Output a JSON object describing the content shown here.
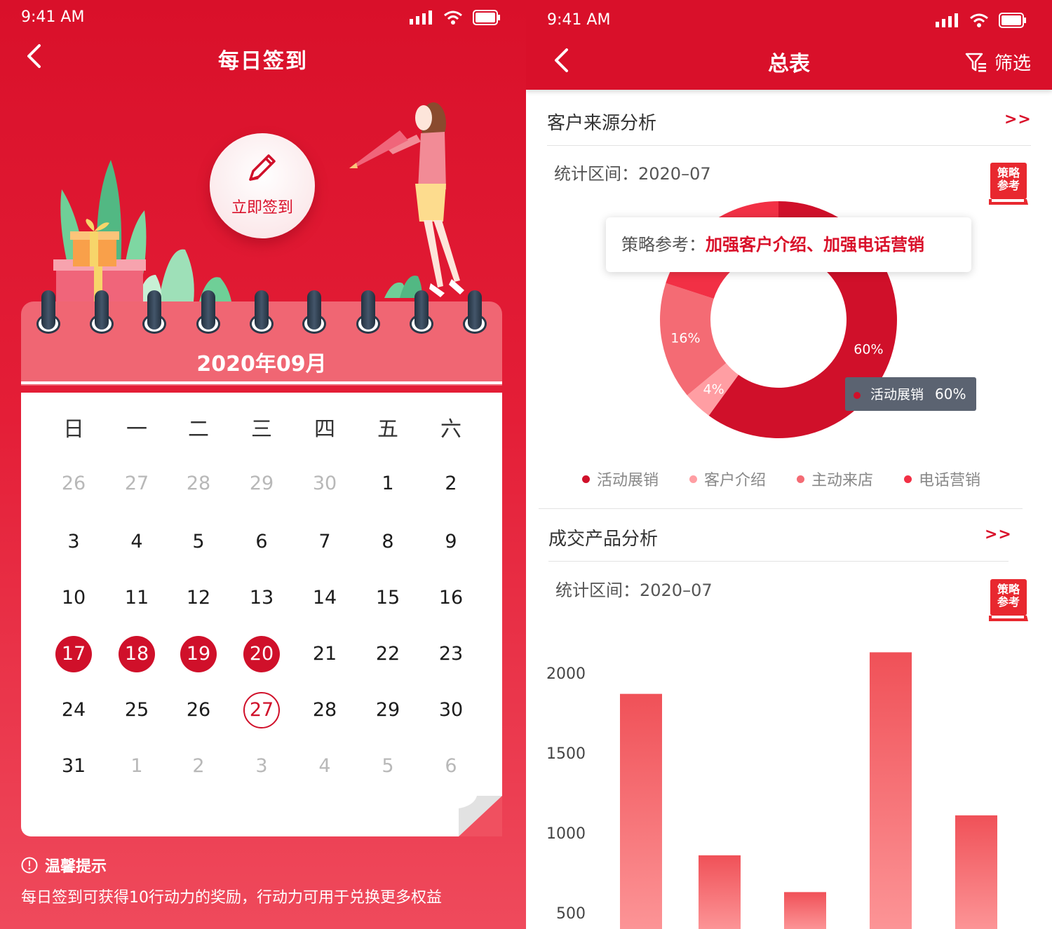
{
  "left": {
    "status": {
      "time": "9:41 AM"
    },
    "nav": {
      "title": "每日签到"
    },
    "checkin_button": {
      "label": "立即签到"
    },
    "calendar": {
      "month": "2020年09月",
      "weekdays": [
        "日",
        "一",
        "二",
        "三",
        "四",
        "五",
        "六"
      ],
      "days": [
        [
          "26",
          "27",
          "28",
          "29",
          "30",
          "1",
          "2"
        ],
        [
          "3",
          "4",
          "5",
          "6",
          "7",
          "8",
          "9"
        ],
        [
          "10",
          "11",
          "12",
          "13",
          "14",
          "15",
          "16"
        ],
        [
          "17",
          "18",
          "19",
          "20",
          "21",
          "22",
          "23"
        ],
        [
          "24",
          "25",
          "26",
          "27",
          "28",
          "29",
          "30"
        ],
        [
          "31",
          "1",
          "2",
          "3",
          "4",
          "5",
          "6"
        ]
      ],
      "signed_days": [
        "17",
        "18",
        "19",
        "20"
      ],
      "today": "27"
    },
    "tip": {
      "title": "温馨提示",
      "text": "每日签到可获得10行动力的奖励，行动力可用于兑换更多权益"
    }
  },
  "right": {
    "status": {
      "time": "9:41 AM"
    },
    "nav": {
      "title": "总表",
      "filter_label": "筛选"
    },
    "customer_source": {
      "title": "客户来源分析",
      "more": ">>",
      "period": "统计区间：2020–07",
      "badge": "策略参考",
      "strategy_key": "策略参考：",
      "strategy_value": "加强客户介绍、加强电话营销",
      "tooltip": {
        "name": "活动展销",
        "value": "60%"
      }
    },
    "product": {
      "title": "成交产品分析",
      "more": ">>",
      "period": "统计区间：2020–07",
      "badge": "策略参考"
    }
  },
  "chart_data": [
    {
      "type": "pie",
      "donut": true,
      "labels": [
        "活动展销",
        "客户介绍",
        "主动来店",
        "电话营销"
      ],
      "values": [
        60,
        4,
        16,
        20
      ],
      "data_labels": [
        "60%",
        "4%",
        "16%",
        ""
      ],
      "colors": [
        "#d0102a",
        "#ff9ea3",
        "#f46b74",
        "#f23045"
      ],
      "legend": "bottom"
    },
    {
      "type": "bar",
      "values": [
        1870,
        860,
        630,
        2130,
        1110
      ],
      "y_ticks": [
        "2000",
        "1500",
        "1000",
        "500"
      ],
      "ylim": [
        200,
        2200
      ],
      "colors": [
        "#f05158",
        "#fc9496"
      ]
    }
  ]
}
